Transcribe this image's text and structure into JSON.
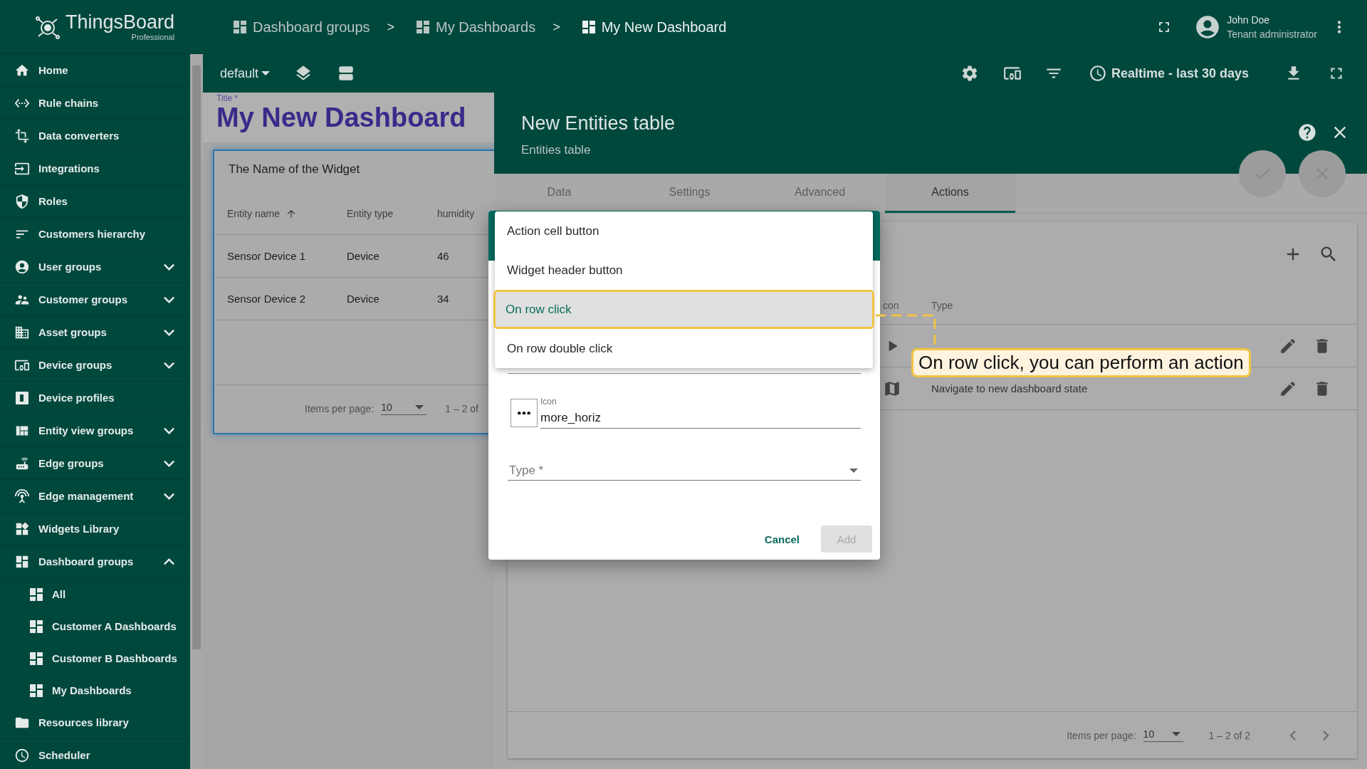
{
  "logo": {
    "name": "ThingsBoard",
    "edition": "Professional"
  },
  "sidebar": {
    "items": [
      {
        "label": "Home",
        "kind": "link"
      },
      {
        "label": "Rule chains",
        "kind": "link"
      },
      {
        "label": "Data converters",
        "kind": "link"
      },
      {
        "label": "Integrations",
        "kind": "link"
      },
      {
        "label": "Roles",
        "kind": "link"
      },
      {
        "label": "Customers hierarchy",
        "kind": "link"
      },
      {
        "label": "User groups",
        "kind": "group",
        "expanded": false
      },
      {
        "label": "Customer groups",
        "kind": "group",
        "expanded": false
      },
      {
        "label": "Asset groups",
        "kind": "group",
        "expanded": false
      },
      {
        "label": "Device groups",
        "kind": "group",
        "expanded": false
      },
      {
        "label": "Device profiles",
        "kind": "link"
      },
      {
        "label": "Entity view groups",
        "kind": "group",
        "expanded": false
      },
      {
        "label": "Edge groups",
        "kind": "group",
        "expanded": false
      },
      {
        "label": "Edge management",
        "kind": "group",
        "expanded": false
      },
      {
        "label": "Widgets Library",
        "kind": "link"
      },
      {
        "label": "Dashboard groups",
        "kind": "group",
        "expanded": true,
        "children": [
          {
            "label": "All"
          },
          {
            "label": "Customer A Dashboards"
          },
          {
            "label": "Customer B Dashboards"
          },
          {
            "label": "My Dashboards"
          }
        ]
      },
      {
        "label": "Resources library",
        "kind": "link"
      },
      {
        "label": "Scheduler",
        "kind": "link"
      }
    ]
  },
  "breadcrumbs": [
    {
      "label": "Dashboard groups",
      "separator": ">",
      "current": false
    },
    {
      "label": "My Dashboards",
      "separator": ">",
      "current": false
    },
    {
      "label": "My New Dashboard",
      "current": true
    }
  ],
  "user": {
    "name": "John Doe",
    "role": "Tenant administrator"
  },
  "toolbar": {
    "state": "default",
    "timewindow": "Realtime - last 30 days"
  },
  "dashboard": {
    "title_label": "Title *",
    "title": "My New Dashboard",
    "widget": {
      "title": "The Name of the Widget",
      "columns": [
        {
          "label": "Entity name",
          "sorted": true
        },
        {
          "label": "Entity type",
          "sorted": false
        },
        {
          "label": "humidity",
          "sorted": false
        }
      ],
      "rows": [
        [
          "Sensor Device 1",
          "Device",
          "46"
        ],
        [
          "Sensor Device 2",
          "Device",
          "34"
        ]
      ],
      "paginator": {
        "label": "Items per page:",
        "page_size": "10",
        "range": "1 – 2 of"
      }
    }
  },
  "panel": {
    "title": "New Entities table",
    "subtitle": "Entities table",
    "tabs": [
      {
        "label": "Data",
        "selected": false
      },
      {
        "label": "Settings",
        "selected": false
      },
      {
        "label": "Advanced",
        "selected": false
      },
      {
        "label": "Actions",
        "selected": true
      }
    ],
    "table": {
      "columns": [
        "con",
        "Type"
      ],
      "rows": [
        {},
        {
          "type": "Navigate to new dashboard state"
        }
      ]
    },
    "paginator": {
      "label": "Items per page:",
      "page_size": "10",
      "range": "1 – 2 of 2"
    }
  },
  "dialog": {
    "menu": [
      {
        "label": "Action cell button",
        "selected": false
      },
      {
        "label": "Widget header button",
        "selected": false
      },
      {
        "label": "On row click",
        "selected": true
      },
      {
        "label": "On row double click",
        "selected": false
      }
    ],
    "icon_field": {
      "label": "Icon",
      "value": "more_horiz"
    },
    "type_field": {
      "placeholder": "Type *"
    },
    "cancel": "Cancel",
    "add": {
      "label": "Add",
      "disabled": true
    }
  },
  "callout": {
    "text": "On row click, you can perform an action"
  }
}
